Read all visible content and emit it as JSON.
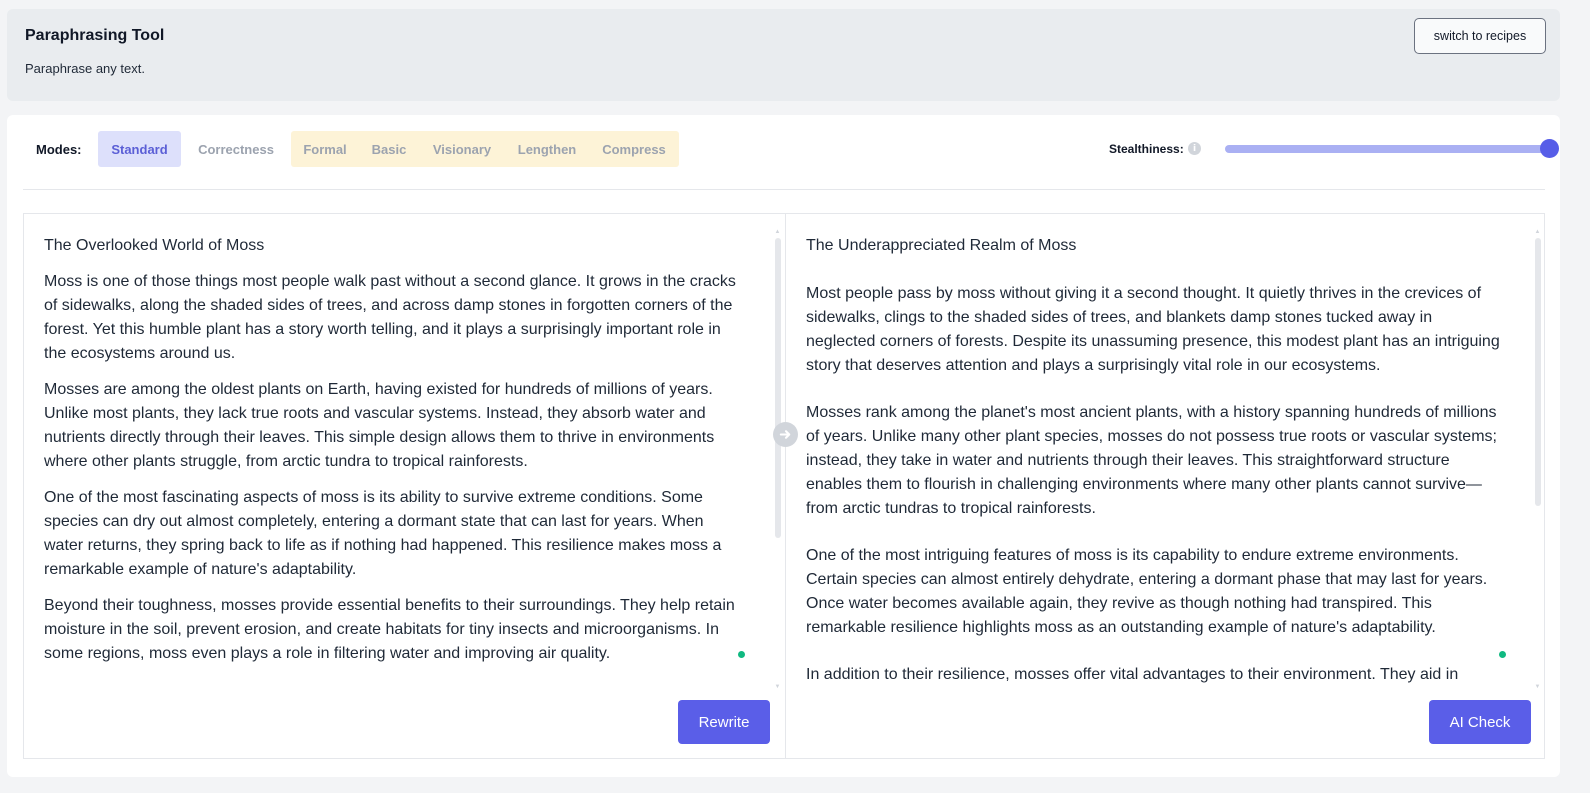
{
  "header": {
    "title": "Paraphrasing Tool",
    "subtitle": "Paraphrase any text.",
    "switch_label": "switch to recipes"
  },
  "modes": {
    "label": "Modes:",
    "items": [
      "Standard",
      "Correctness",
      "Formal",
      "Basic",
      "Visionary",
      "Lengthen",
      "Compress"
    ],
    "active": "Standard"
  },
  "stealthiness": {
    "label": "Stealthiness:",
    "info_icon": "info-icon",
    "level_fraction": 1.0
  },
  "input": {
    "title": "The Overlooked World of Moss",
    "paragraphs": [
      "Moss is one of those things most people walk past without a second glance. It grows in the cracks of sidewalks, along the shaded sides of trees, and across damp stones in forgotten corners of the forest. Yet this humble plant has a story worth telling, and it plays a surprisingly important role in the ecosystems around us.",
      "Mosses are among the oldest plants on Earth, having existed for hundreds of millions of years. Unlike most plants, they lack true roots and vascular systems. Instead, they absorb water and nutrients directly through their leaves. This simple design allows them to thrive in environments where other plants struggle, from arctic tundra to tropical rainforests.",
      "One of the most fascinating aspects of moss is its ability to survive extreme conditions. Some species can dry out almost completely, entering a dormant state that can last for years. When water returns, they spring back to life as if nothing had happened. This resilience makes moss a remarkable example of nature's adaptability.",
      "Beyond their toughness, mosses provide essential benefits to their surroundings. They help retain moisture in the soil, prevent erosion, and create habitats for tiny insects and microorganisms. In some regions, moss even plays a role in filtering water and improving air quality."
    ],
    "button_label": "Rewrite"
  },
  "output": {
    "title": "The Underappreciated Realm of Moss",
    "paragraphs": [
      "Most people pass by moss without giving it a second thought. It quietly thrives in the crevices of sidewalks, clings to the shaded sides of trees, and blankets damp stones tucked away in neglected corners of forests. Despite its unassuming presence, this modest plant has an intriguing story that deserves attention and plays a surprisingly vital role in our ecosystems.",
      "Mosses rank among the planet's most ancient plants, with a history spanning hundreds of millions of years. Unlike many other plant species, mosses do not possess true roots or vascular systems; instead, they take in water and nutrients through their leaves. This straightforward structure enables them to flourish in challenging environments where many other plants cannot survive—from arctic tundras to tropical rainforests.",
      "One of the most intriguing features of moss is its capability to endure extreme environments. Certain species can almost entirely dehydrate, entering a dormant phase that may last for years. Once water becomes available again, they revive as though nothing had transpired. This remarkable resilience highlights moss as an outstanding example of nature's adaptability.",
      "In addition to their resilience, mosses offer vital advantages to their environment. They aid in"
    ],
    "button_label": "AI Check"
  },
  "colors": {
    "accent": "#5a5ee8",
    "active_mode_bg": "#dde0fb",
    "premium_modes_bg": "#fdf3d7",
    "status_dot": "#10b981"
  }
}
